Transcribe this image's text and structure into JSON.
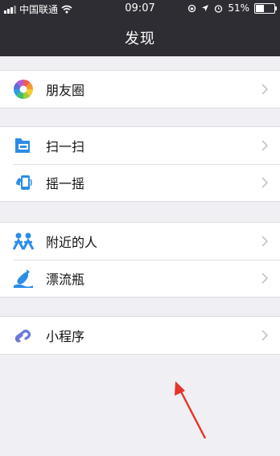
{
  "status_bar": {
    "carrier": "中国联通",
    "time": "09:07",
    "battery": "51%",
    "battery_level": 0.51
  },
  "header": {
    "title": "发现"
  },
  "groups": [
    {
      "items": [
        {
          "label": "朋友圈",
          "icon": "moments-icon"
        }
      ]
    },
    {
      "items": [
        {
          "label": "扫一扫",
          "icon": "scan-icon"
        },
        {
          "label": "摇一摇",
          "icon": "shake-icon"
        }
      ]
    },
    {
      "items": [
        {
          "label": "附近的人",
          "icon": "people-nearby-icon"
        },
        {
          "label": "漂流瓶",
          "icon": "drift-bottle-icon"
        }
      ]
    },
    {
      "items": [
        {
          "label": "小程序",
          "icon": "mini-program-icon"
        }
      ]
    }
  ],
  "colors": {
    "nav_bar": "#2e2d33",
    "background": "#efeff4",
    "annotation_arrow": "#e8332a"
  }
}
